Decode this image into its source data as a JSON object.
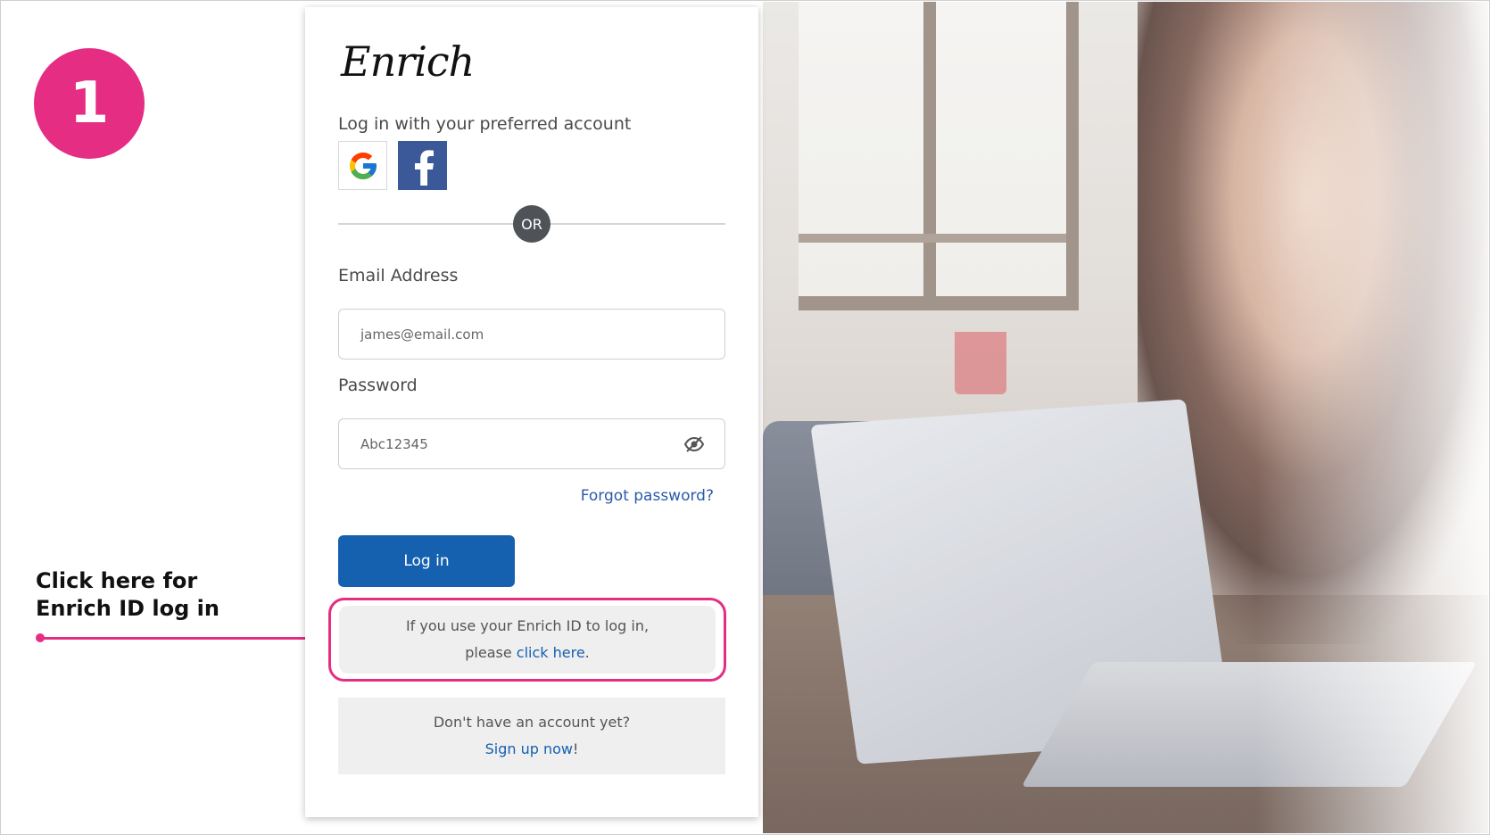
{
  "step": {
    "number": "1",
    "color": "#e52d84"
  },
  "callout": {
    "text": "Click here for\nEnrich ID log in"
  },
  "login": {
    "brand": "Enrich",
    "social_prompt": "Log in with your preferred account",
    "social": [
      {
        "icon": "google-icon",
        "label": "G"
      },
      {
        "icon": "facebook-icon",
        "label": "f"
      }
    ],
    "or_label": "OR",
    "email_label": "Email Address",
    "email_value": "james@email.com",
    "password_label": "Password",
    "password_value": "Abc12345",
    "forgot_link": "Forgot password?",
    "login_button": "Log in",
    "enrich_id_line1": "If you use your Enrich ID to log in,",
    "enrich_id_prefix": "please ",
    "enrich_id_link": "click here",
    "enrich_id_suffix": ".",
    "signup_prompt": "Don't have an account yet?",
    "signup_link": "Sign up now",
    "signup_suffix": "!"
  },
  "colors": {
    "accent": "#e52d84",
    "primary_button": "#1660b0",
    "facebook": "#3b5998",
    "or_badge": "#4f5358"
  }
}
